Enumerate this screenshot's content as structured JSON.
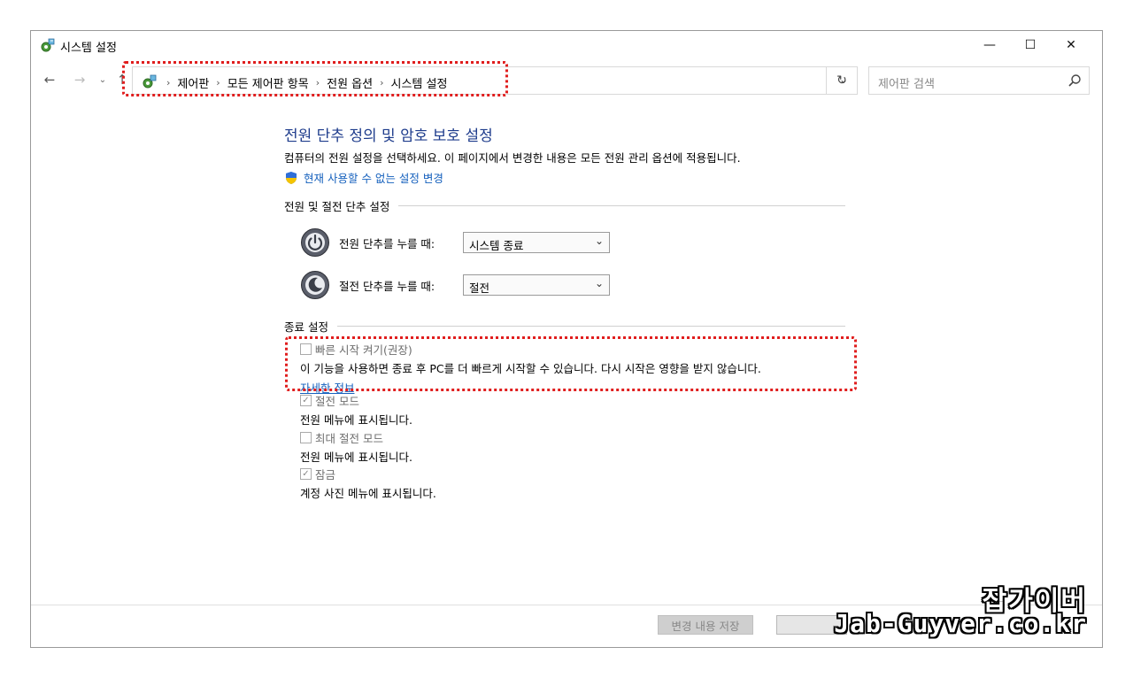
{
  "window": {
    "title": "시스템 설정",
    "title_icon": "control-panel-gear-icon",
    "minimize": "—",
    "maximize": "☐",
    "close": "✕"
  },
  "nav": {
    "back": "←",
    "forward": "→",
    "recent": "⌄",
    "up": "↑",
    "breadcrumbs": [
      "제어판",
      "모든 제어판 항목",
      "전원 옵션",
      "시스템 설정"
    ],
    "separator": "›",
    "dropdown": "⌄",
    "refresh": "↻",
    "search_placeholder": "제어판 검색"
  },
  "content": {
    "heading": "전원 단추 정의 및 암호 보호 설정",
    "description": "컴퓨터의 전원 설정을 선택하세요. 이 페이지에서 변경한 내용은 모든 전원 관리 옵션에 적용됩니다.",
    "admin_link": "현재 사용할 수 없는 설정 변경",
    "power_section": {
      "title": "전원 및 절전 단추 설정",
      "power_button_label": "전원 단추를 누를 때:",
      "power_button_value": "시스템 종료",
      "sleep_button_label": "절전 단추를 누를 때:",
      "sleep_button_value": "절전"
    },
    "shutdown_section": {
      "title": "종료 설정",
      "options": [
        {
          "title": "빠른 시작 켜기(권장)",
          "checked": false,
          "desc": "이 기능을 사용하면 종료 후 PC를 더 빠르게 시작할 수 있습니다. 다시 시작은 영향을 받지 않습니다.",
          "link": "자세한 정보"
        },
        {
          "title": "절전 모드",
          "checked": true,
          "desc": "전원 메뉴에 표시됩니다."
        },
        {
          "title": "최대 절전 모드",
          "checked": false,
          "desc": "전원 메뉴에 표시됩니다."
        },
        {
          "title": "잠금",
          "checked": true,
          "desc": "계정 사진 메뉴에 표시됩니다."
        }
      ]
    }
  },
  "footer": {
    "save_label": "변경 내용 저장",
    "cancel_label": ""
  },
  "watermark": {
    "korean": "잡가이버",
    "url": "Jab-Guyver.co.kr"
  },
  "colors": {
    "heading": "#1e3c8c",
    "link": "#1560bd",
    "highlight": "#e01e1e"
  }
}
